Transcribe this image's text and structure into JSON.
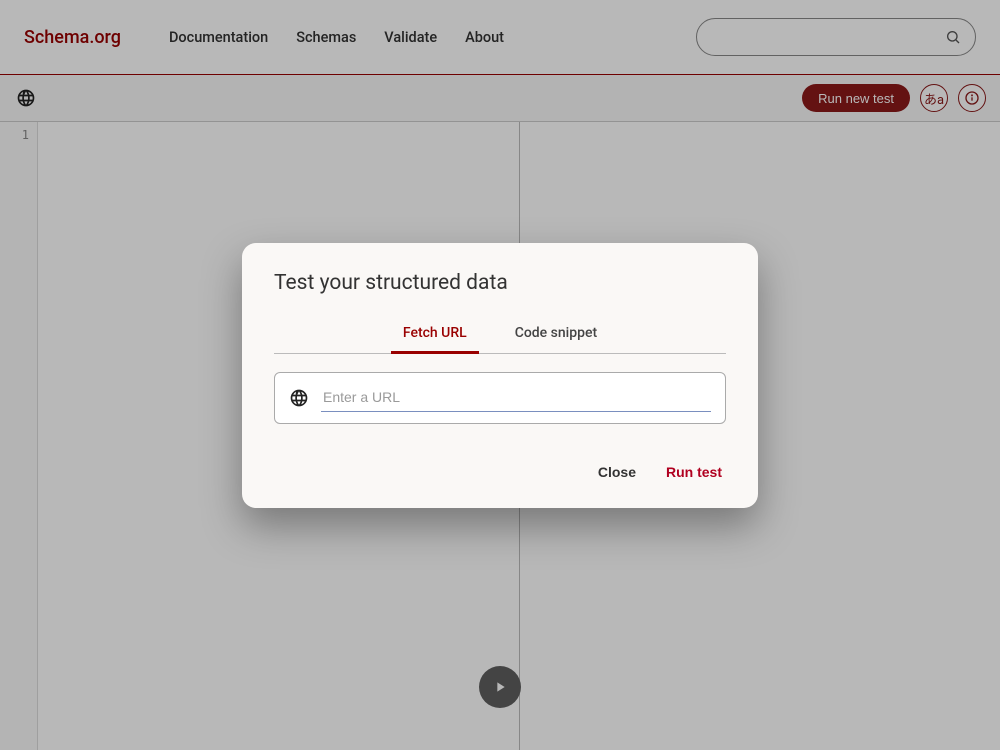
{
  "brand": "Schema.org",
  "nav": {
    "documentation": "Documentation",
    "schemas": "Schemas",
    "validate": "Validate",
    "about": "About"
  },
  "search": {
    "placeholder": ""
  },
  "toolbar": {
    "run_new_test": "Run new test",
    "lang_label": "あa"
  },
  "editor": {
    "line1": "1"
  },
  "modal": {
    "title": "Test your structured data",
    "tabs": {
      "fetch_url": "Fetch URL",
      "code_snippet": "Code snippet"
    },
    "url_placeholder": "Enter a URL",
    "close": "Close",
    "run_test": "Run test"
  }
}
